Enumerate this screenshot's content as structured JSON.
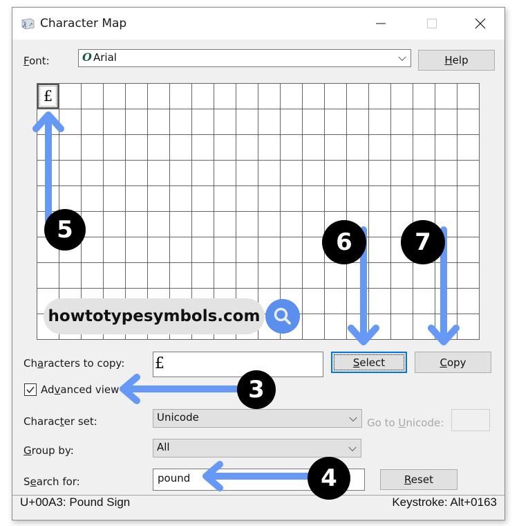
{
  "window": {
    "title": "Character Map",
    "controls": {
      "minimize": "minimize",
      "maximize": "maximize",
      "close": "close"
    }
  },
  "font": {
    "label_prefix": "",
    "label_accel": "F",
    "label_rest": "ont:",
    "value": "Arial",
    "font_icon": "O"
  },
  "help_button": {
    "accel": "H",
    "rest": "elp"
  },
  "grid": {
    "columns": 20,
    "rows": 10,
    "selected_char": "£"
  },
  "characters_to_copy": {
    "label_pre": "Ch",
    "label_accel": "a",
    "label_rest": "racters to copy:",
    "value": "£"
  },
  "select_button": {
    "accel": "S",
    "rest": "elect"
  },
  "copy_button": {
    "accel": "C",
    "rest": "opy"
  },
  "advanced_view": {
    "checked": true,
    "label_pre": "Ad",
    "label_accel": "v",
    "label_rest": "anced view"
  },
  "character_set": {
    "label_pre": "Charac",
    "label_accel": "t",
    "label_rest": "er set:",
    "value": "Unicode"
  },
  "goto_unicode": {
    "label_pre": "Go to ",
    "label_accel": "U",
    "label_rest": "nicode:",
    "value": ""
  },
  "group_by": {
    "label_accel": "G",
    "label_rest": "roup by:",
    "value": "All"
  },
  "search_for": {
    "label_pre": "S",
    "label_accel": "e",
    "label_rest": "arch for:",
    "value": "pound"
  },
  "reset_button": {
    "accel": "R",
    "rest": "eset"
  },
  "status": {
    "char_info": "U+00A3: Pound Sign",
    "keystroke": "Keystroke: Alt+0163"
  },
  "annotations": {
    "steps": [
      "3",
      "4",
      "5",
      "6",
      "7"
    ],
    "arrow_color": "#6699f5",
    "watermark": "howtotypesymbols.com"
  }
}
